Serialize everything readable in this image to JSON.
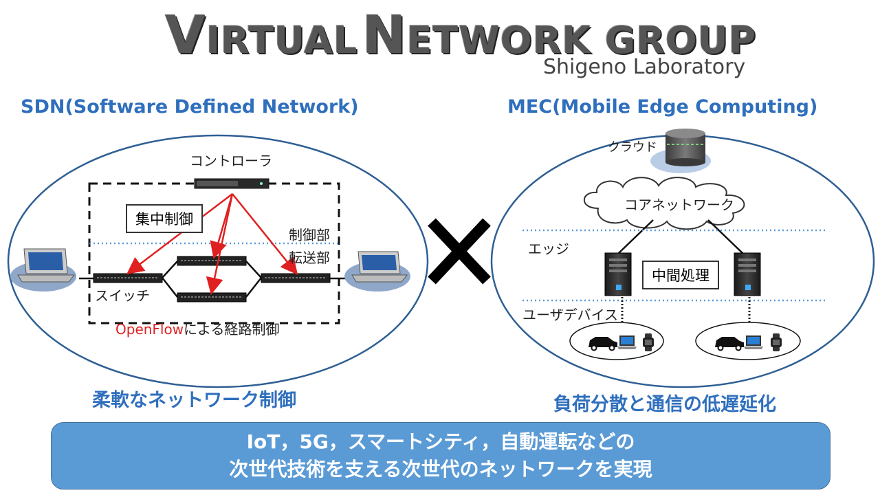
{
  "header": {
    "title_big_1": "V",
    "title_small_1": "IRTUAL",
    "title_big_2": "N",
    "title_small_2": "ETWORK GROUP",
    "subtitle": "Shigeno Laboratory"
  },
  "sdn": {
    "heading": "SDN(Software Defined Network)",
    "controller_label": "コントローラ",
    "central_control_label": "集中制御",
    "control_part_label": "制御部",
    "forward_part_label": "転送部",
    "switch_label": "スイッチ",
    "openflow_label": "OpenFlow",
    "route_control_label": "による経路制御",
    "benefit": "柔軟なネットワーク制御"
  },
  "cross_symbol": "✕",
  "mec": {
    "heading": "MEC(Mobile Edge Computing)",
    "cloud_label": "クラウド",
    "core_network_label": "コアネットワーク",
    "edge_label": "エッジ",
    "intermediate_label": "中間処理",
    "user_device_label": "ユーザデバイス",
    "benefit": "負荷分散と通信の低遅延化"
  },
  "banner": {
    "line1": "IoT，5G，スマートシティ，自動運転などの",
    "line2": "次世代技術を支える次世代のネットワークを実現"
  },
  "colors": {
    "accent_blue": "#2f6fbd",
    "banner_blue": "#5b9bd5",
    "arrow_red": "#e02020",
    "openflow_red": "#e02020",
    "ellipse_stroke": "#2e5f93"
  }
}
